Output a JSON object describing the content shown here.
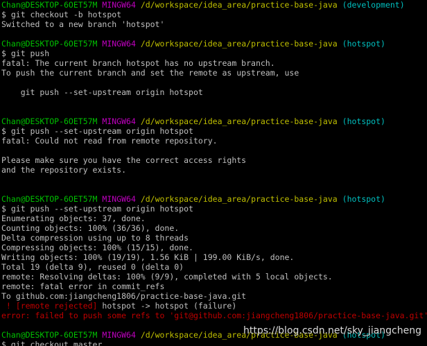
{
  "colors": {
    "background": "#000000",
    "text": "#c0c0c0",
    "user": "#00c000",
    "msys": "#c000c0",
    "path": "#c0c000",
    "branch": "#00c0c0",
    "error": "#c00000"
  },
  "prompt": {
    "user_host": "Chan@DESKTOP-6OET57M",
    "msys": "MINGW64",
    "path": "/d/workspace/idea_area/practice-base-java"
  },
  "blocks": [
    {
      "branch": "(development)",
      "command": "$ git checkout -b hotspot",
      "output": [
        "Switched to a new branch 'hotspot'"
      ]
    },
    {
      "branch": "(hotspot)",
      "command": "$ git push",
      "output": [
        "fatal: The current branch hotspot has no upstream branch.",
        "To push the current branch and set the remote as upstream, use",
        "",
        "    git push --set-upstream origin hotspot",
        ""
      ]
    },
    {
      "branch": "(hotspot)",
      "command": "$ git push --set-upstream origin hotspot",
      "output": [
        "fatal: Could not read from remote repository.",
        "",
        "Please make sure you have the correct access rights",
        "and the repository exists.",
        ""
      ]
    },
    {
      "branch": "(hotspot)",
      "command": "$ git push --set-upstream origin hotspot",
      "output": [
        "Enumerating objects: 37, done.",
        "Counting objects: 100% (36/36), done.",
        "Delta compression using up to 8 threads",
        "Compressing objects: 100% (15/15), done.",
        "Writing objects: 100% (19/19), 1.56 KiB | 199.00 KiB/s, done.",
        "Total 19 (delta 9), reused 0 (delta 0)",
        "remote: Resolving deltas: 100% (9/9), completed with 5 local objects.",
        "remote: fatal error in commit_refs",
        "To github.com:jiangcheng1806/practice-base-java.git"
      ],
      "rejected": {
        "prefix": " ! ",
        "tag": "[remote rejected]",
        "rest": " hotspot -> hotspot (failure)"
      },
      "error": "error: failed to push some refs to 'git@github.com:jiangcheng1806/practice-base-java.git'"
    },
    {
      "branch": "(hotspot)",
      "command": "$ git checkout master",
      "output": []
    }
  ],
  "watermark": "https://blog.csdn.net/sky_jiangcheng"
}
